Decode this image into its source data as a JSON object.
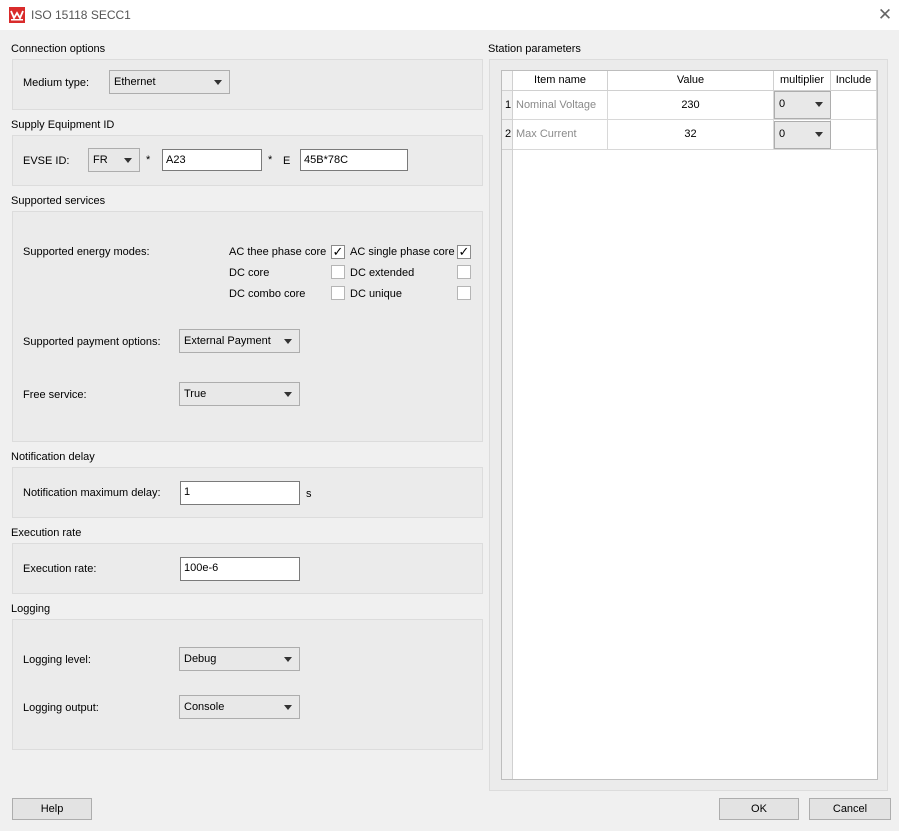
{
  "window": {
    "title": "ISO 15118 SECC1",
    "icon": "app-logo-icon",
    "close_symbol": "✕"
  },
  "connection": {
    "section_label": "Connection options",
    "medium_label": "Medium type:",
    "medium_value": "Ethernet"
  },
  "supply": {
    "section_label": "Supply Equipment ID",
    "evse_label": "EVSE ID:",
    "country_value": "FR",
    "sep1": "*",
    "operator_value": "A23",
    "sep2": "*",
    "e_label": "E",
    "id_value": "45B*78C"
  },
  "services": {
    "section_label": "Supported services",
    "energy_label": "Supported energy modes:",
    "modes": {
      "ac_three": {
        "label": "AC thee phase core",
        "checked": "✓"
      },
      "ac_single": {
        "label": "AC single phase core",
        "checked": "✓"
      },
      "dc_core": {
        "label": "DC core",
        "checked": ""
      },
      "dc_extended": {
        "label": "DC extended",
        "checked": ""
      },
      "dc_combo": {
        "label": "DC combo core",
        "checked": ""
      },
      "dc_unique": {
        "label": "DC unique",
        "checked": ""
      }
    },
    "payment_label": "Supported payment options:",
    "payment_value": "External Payment",
    "free_label": "Free service:",
    "free_value": "True"
  },
  "notification": {
    "section_label": "Notification delay",
    "max_delay_label": "Notification maximum delay:",
    "max_delay_value": "1",
    "unit": "s"
  },
  "execution": {
    "section_label": "Execution rate",
    "rate_label": "Execution rate:",
    "rate_value": "100e-6"
  },
  "logging": {
    "section_label": "Logging",
    "level_label": "Logging level:",
    "level_value": "Debug",
    "output_label": "Logging output:",
    "output_value": "Console"
  },
  "station": {
    "section_label": "Station parameters",
    "headers": [
      "Item name",
      "Value",
      "multiplier",
      "Include"
    ],
    "rows": [
      {
        "num": "1",
        "name": "Nominal Voltage",
        "value": "230",
        "multiplier": "0",
        "include": ""
      },
      {
        "num": "2",
        "name": "Max Current",
        "value": "32",
        "multiplier": "0",
        "include": ""
      }
    ]
  },
  "buttons": {
    "help": "Help",
    "ok": "OK",
    "cancel": "Cancel"
  },
  "colors": {
    "background": "#f0f0f0",
    "group_bg": "#ebebeb",
    "logo_red": "#d92b2b"
  }
}
